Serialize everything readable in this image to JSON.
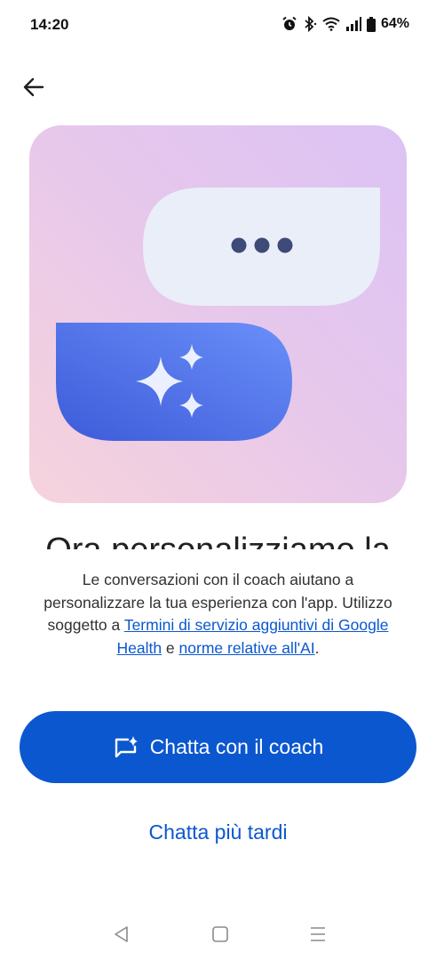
{
  "status_bar": {
    "time": "14:20",
    "battery": "64%",
    "icons": [
      "alarm-icon",
      "bluetooth-icon",
      "wifi-icon",
      "signal-icon",
      "battery-icon"
    ]
  },
  "header": {
    "back_icon": "arrow-back-icon"
  },
  "hero": {
    "colors": {
      "gradient_top_right": "#dcc3f4",
      "gradient_bottom_left": "#f6d3dc",
      "bubble_light": "#e9eef8",
      "dots": "#3e4a78",
      "bubble_blue_start": "#6a8ff9",
      "bubble_blue_end": "#3d5bd9"
    }
  },
  "content": {
    "title_partial": "Ora personalizziamo la",
    "description_plain_1": "Le conversazioni con il coach aiutano a personalizzare la tua esperienza con l'app. Utilizzo soggetto a ",
    "terms_link": "Termini di servizio aggiuntivi di Google Health",
    "description_plain_2": " e ",
    "ai_link": "norme relative all'AI",
    "description_plain_3": "."
  },
  "actions": {
    "primary_label": "Chatta con il coach",
    "primary_icon": "chat-sparkle-icon",
    "secondary_label": "Chatta più tardi",
    "accent_color": "#0b57d0"
  },
  "nav_bar": {
    "icons": [
      "nav-back-icon",
      "nav-home-icon",
      "nav-recents-icon"
    ]
  }
}
